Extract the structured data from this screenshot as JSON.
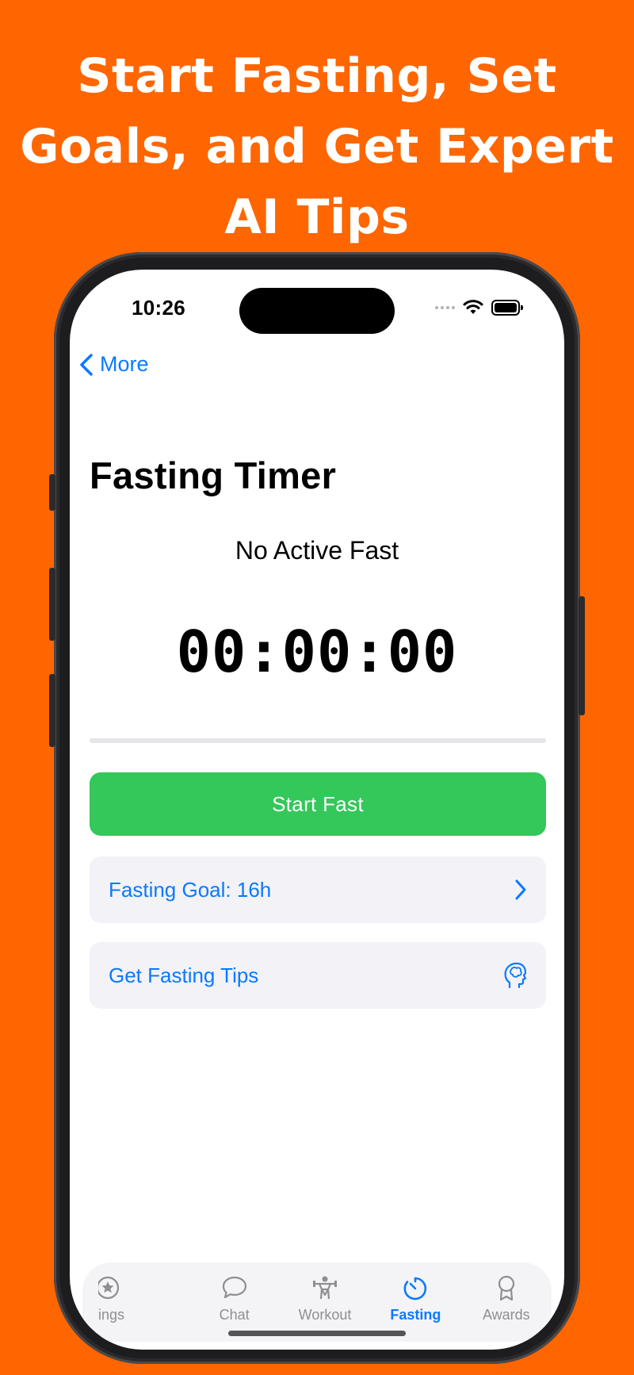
{
  "headline": [
    "Start Fasting, Set",
    "Goals, and Get Expert",
    "AI Tips"
  ],
  "status_bar": {
    "time": "10:26"
  },
  "nav": {
    "back_label": "More"
  },
  "page": {
    "title": "Fasting Timer",
    "status": "No Active Fast",
    "timer": "00:00:00",
    "progress": 0
  },
  "actions": {
    "start_label": "Start Fast",
    "goal_label": "Fasting Goal: 16h",
    "tips_label": "Get Fasting Tips"
  },
  "tabs": [
    {
      "label": "ings",
      "icon": "star-circle-icon",
      "active": false
    },
    {
      "label": "Chat",
      "icon": "chat-bubble-icon",
      "active": false
    },
    {
      "label": "Workout",
      "icon": "weightlifter-icon",
      "active": false
    },
    {
      "label": "Fasting",
      "icon": "timer-icon",
      "active": true
    },
    {
      "label": "Awards",
      "icon": "award-ribbon-icon",
      "active": false
    }
  ],
  "colors": {
    "background": "#FF6600",
    "accent": "#0A7AFF",
    "start_button": "#34C759",
    "row_background": "#F2F2F7"
  }
}
